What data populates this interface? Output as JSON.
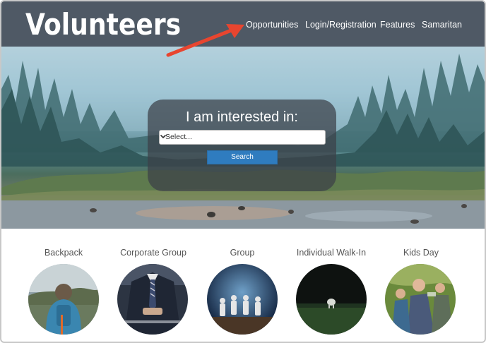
{
  "brand": {
    "logo_text": "Volunteers"
  },
  "nav": {
    "items": [
      {
        "label": "Opportunities"
      },
      {
        "label": "Login/Registration"
      },
      {
        "label": "Features"
      },
      {
        "label": "Samaritan"
      }
    ]
  },
  "search": {
    "heading": "I am interested in:",
    "select_value": "Select...",
    "button_label": "Search"
  },
  "categories": [
    {
      "label": "Backpack"
    },
    {
      "label": "Corporate Group"
    },
    {
      "label": "Group"
    },
    {
      "label": "Individual Walk-In"
    },
    {
      "label": "Kids Day"
    }
  ],
  "colors": {
    "header_bg": "#4f5965",
    "search_button": "#2f7cbf",
    "annotation_arrow": "#e8452f"
  }
}
